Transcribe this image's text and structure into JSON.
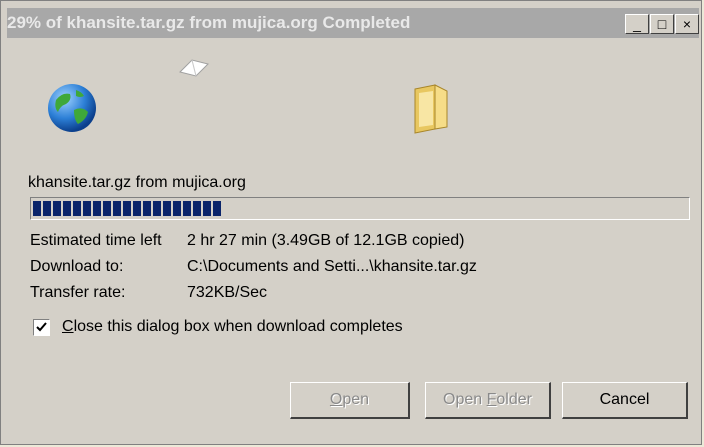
{
  "window": {
    "title": "29% of khansite.tar.gz from mujica.org Completed",
    "controls": {
      "minimize": "_",
      "maximize": "□",
      "close": "×"
    }
  },
  "icons": {
    "source": "globe-icon",
    "flying": "paper-icon",
    "destination": "folder-icon"
  },
  "download": {
    "filename_line": "khansite.tar.gz from mujica.org",
    "progress_percent": 29,
    "rows": [
      {
        "label": "Estimated time left",
        "value": "2 hr 27 min (3.49GB of 12.1GB copied)"
      },
      {
        "label": "Download to:",
        "value": "C:\\Documents and Setti...\\khansite.tar.gz"
      },
      {
        "label": "Transfer rate:",
        "value": "732KB/Sec"
      }
    ]
  },
  "checkbox": {
    "checked": true,
    "label_first_char": "C",
    "label_rest": "lose this dialog box when download completes"
  },
  "buttons": {
    "open": {
      "mnemonic": "O",
      "rest": "pen",
      "enabled": false
    },
    "open_folder": {
      "prefix": "Open ",
      "mnemonic": "F",
      "rest": "older",
      "enabled": false
    },
    "cancel": {
      "label": "Cancel",
      "enabled": true
    }
  }
}
